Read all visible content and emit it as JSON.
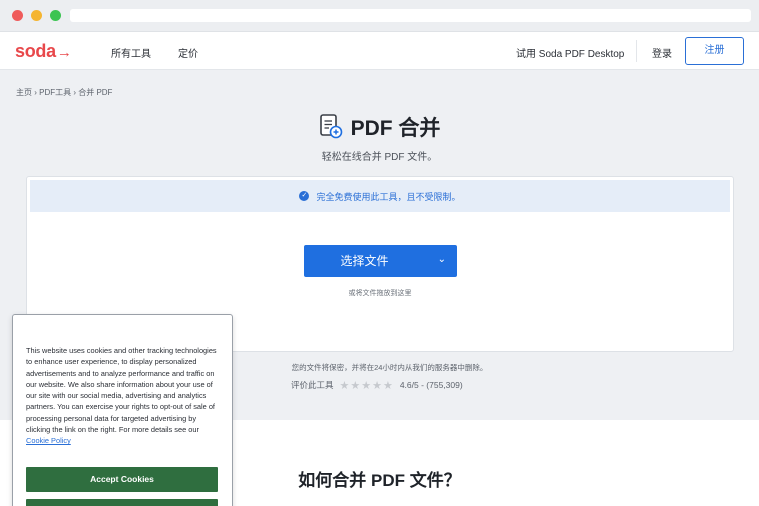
{
  "logo": {
    "text": "soda",
    "arrow": "→"
  },
  "nav": {
    "tools": "所有工具",
    "pricing": "定价",
    "desktop": "试用 Soda PDF Desktop",
    "login": "登录",
    "signup": "注册"
  },
  "breadcrumb": "主页 › PDF工具 › 合并 PDF",
  "page": {
    "title": "PDF 合并",
    "subtitle": "轻松在线合并 PDF 文件。"
  },
  "card": {
    "banner": "完全免费使用此工具，且不受限制。",
    "choose_button": "选择文件",
    "caret": "⌄",
    "drop_hint": "或将文件拖放到这里"
  },
  "privacy": "您的文件将保密，并将在24小时内从我们的服务器中删除。",
  "rating": {
    "label": "评价此工具",
    "stars": "★★★★★",
    "value": "4.6/5 - (755,309)"
  },
  "how_title": "如何合并 PDF 文件？",
  "cookie": {
    "text": "This website uses cookies and other tracking technologies to enhance user experience, to display personalized advertisements and to analyze performance and traffic on our website. We also share information about your use of our site with our social media, advertising and analytics partners. You can exercise your rights to opt-out of sale of processing personal data for targeted advertising by clicking the link on the right. For more details see our ",
    "link": "Cookie Policy",
    "accept": "Accept Cookies"
  },
  "colors": {
    "brand": "#e8484b",
    "primary": "#1f6fe0",
    "cookie_button": "#2f6e3f"
  }
}
